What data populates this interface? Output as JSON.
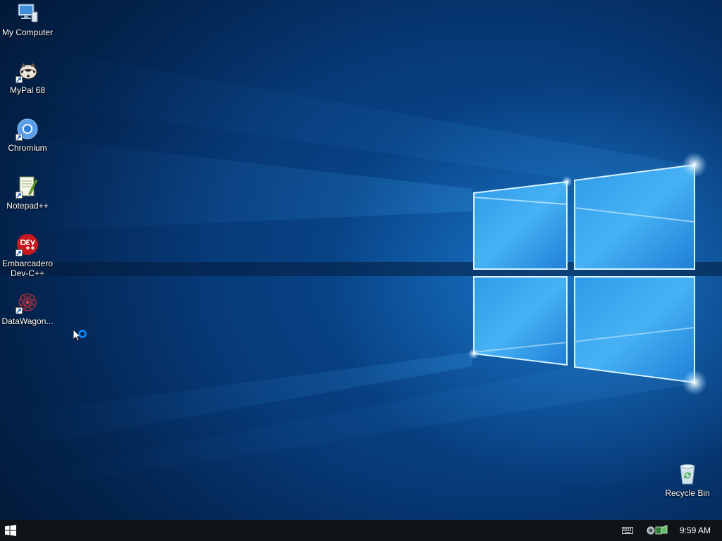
{
  "desktop": {
    "icons": [
      {
        "label": "My Computer",
        "icon": "computer-icon"
      },
      {
        "label": "MyPal 68",
        "icon": "mypal-raccoon-icon"
      },
      {
        "label": "Chromium",
        "icon": "chromium-icon"
      },
      {
        "label": "Notepad++",
        "icon": "notepadpp-icon"
      },
      {
        "label": "Embarcadero\nDev-C++",
        "icon": "devcpp-icon"
      },
      {
        "label": "DataWagon...",
        "icon": "datawagon-icon"
      }
    ],
    "recycle_bin": {
      "label": "Recycle Bin",
      "icon": "recycle-bin-icon"
    }
  },
  "taskbar": {
    "start_icon": "windows-logo-icon",
    "tray": {
      "keyboard_icon": "keyboard-icon",
      "network_icon": "network-icon",
      "clock": "9:59 AM"
    }
  },
  "colors": {
    "taskbar_bg": "#101318",
    "desktop_dark": "#021733",
    "desktop_mid": "#0a4f98",
    "window_light": "#39a8f0"
  }
}
